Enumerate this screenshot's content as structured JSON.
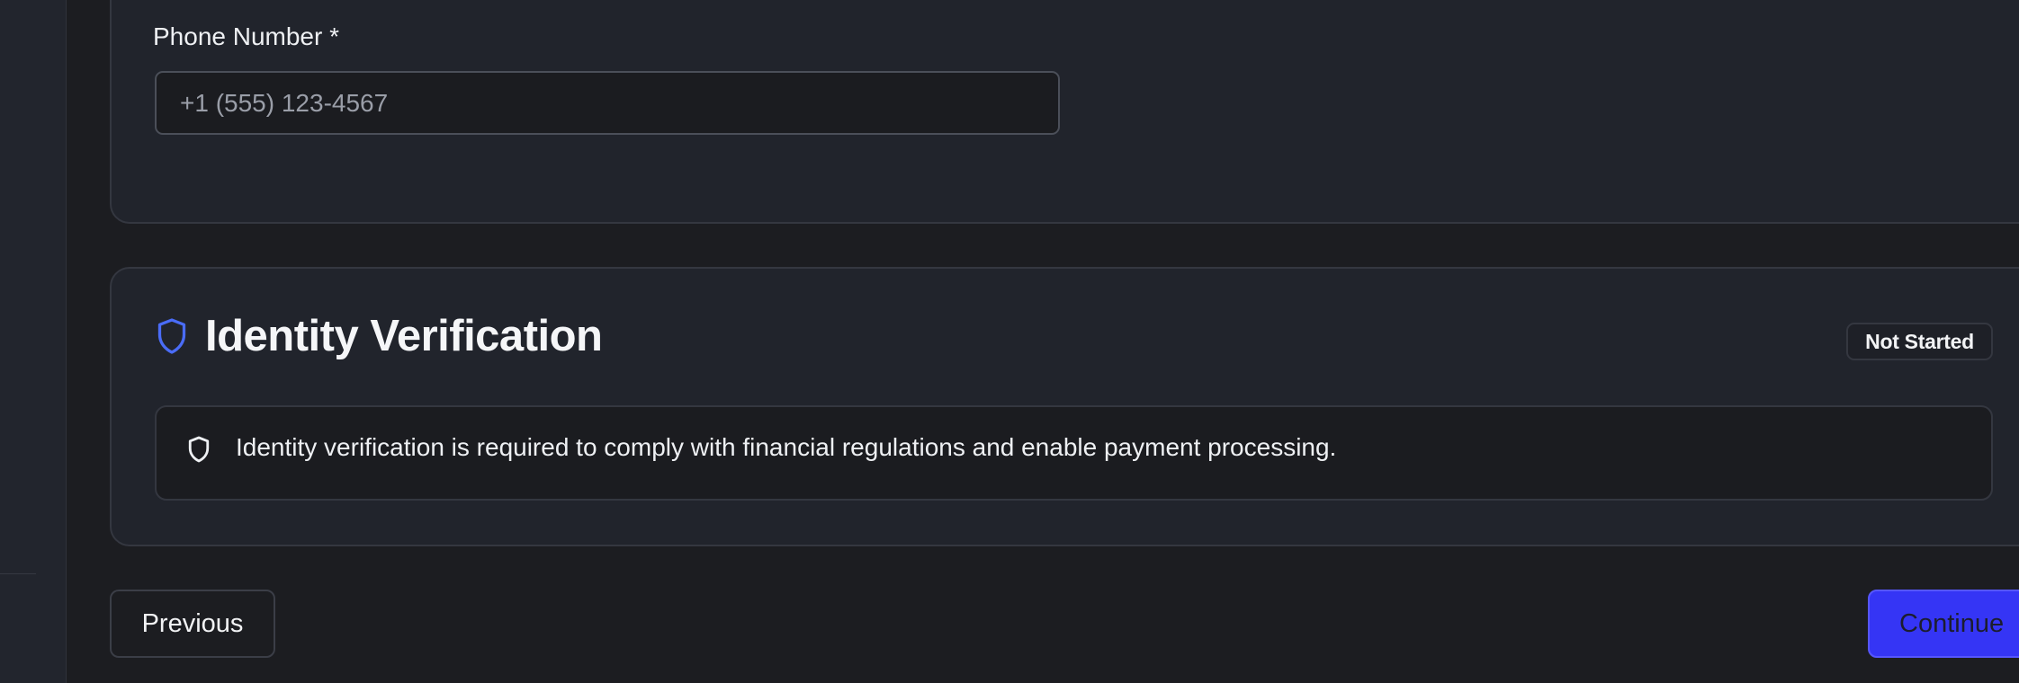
{
  "sidebar": {},
  "contact": {
    "phone_label": "Phone Number *",
    "phone_value": "",
    "phone_placeholder": "+1 (555) 123-4567"
  },
  "identity": {
    "title": "Identity Verification",
    "title_icon": "shield-icon",
    "status": "Not Started",
    "notice_icon": "shield-icon",
    "notice": "Identity verification is required to comply with financial regulations and enable payment processing."
  },
  "navigation": {
    "previous_label": "Previous",
    "continue_label": "Continue"
  },
  "colors": {
    "background": "#1c1d21",
    "card": "#21242c",
    "accent": "#3535f5",
    "icon_blue": "#4a6cf7"
  }
}
